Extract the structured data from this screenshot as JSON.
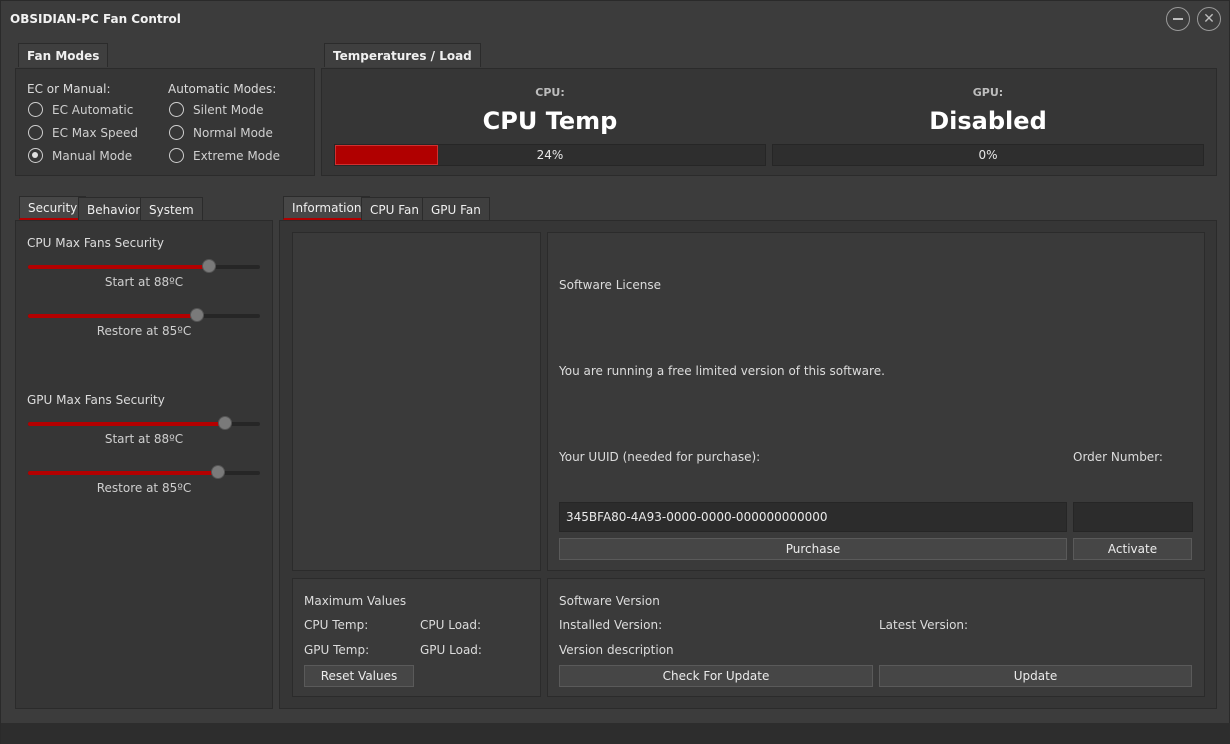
{
  "window": {
    "title": "OBSIDIAN-PC Fan Control"
  },
  "fan_modes": {
    "tab_label": "Fan Modes",
    "ec_manual_title": "EC or Manual:",
    "automatic_title": "Automatic Modes:",
    "ec_options": [
      {
        "label": "EC Automatic",
        "selected": false
      },
      {
        "label": "EC Max Speed",
        "selected": false
      },
      {
        "label": "Manual Mode",
        "selected": true
      }
    ],
    "auto_options": [
      {
        "label": "Silent Mode",
        "selected": false
      },
      {
        "label": "Normal Mode",
        "selected": false
      },
      {
        "label": "Extreme Mode",
        "selected": false
      }
    ]
  },
  "temps": {
    "tab_label": "Temperatures / Load",
    "cpu": {
      "heading": "CPU:",
      "value": "CPU Temp",
      "load_text": "24%",
      "load": 0.24
    },
    "gpu": {
      "heading": "GPU:",
      "value": "Disabled",
      "load_text": "0%",
      "load": 0
    }
  },
  "left_tabs": [
    "Security",
    "Behavior",
    "System"
  ],
  "security": {
    "cpu_title": "CPU Max Fans Security",
    "cpu_start_label": "Start at 88ºC",
    "cpu_start_level": 0.78,
    "cpu_restore_label": "Restore at 85ºC",
    "cpu_restore_level": 0.73,
    "gpu_title": "GPU Max Fans Security",
    "gpu_start_label": "Start at 88ºC",
    "gpu_start_level": 0.85,
    "gpu_restore_label": "Restore at 85ºC",
    "gpu_restore_level": 0.82
  },
  "right_tabs": [
    "Information",
    "CPU Fan",
    "GPU Fan"
  ],
  "license": {
    "title": "Software License",
    "message": "You are running a free limited version of this software.",
    "uuid_label": "Your UUID (needed for purchase):",
    "order_label": "Order Number:",
    "uuid_value": "345BFA80-4A93-0000-0000-000000000000",
    "order_value": "",
    "purchase_label": "Purchase",
    "activate_label": "Activate"
  },
  "max_values": {
    "title": "Maximum Values",
    "cpu_temp": "CPU Temp:",
    "cpu_load": "CPU Load:",
    "gpu_temp": "GPU Temp:",
    "gpu_load": "GPU Load:",
    "reset_label": "Reset Values"
  },
  "version": {
    "title": "Software Version",
    "installed": "Installed Version:",
    "latest": "Latest Version:",
    "description": "Version description",
    "check_label": "Check For Update",
    "update_label": "Update"
  },
  "colors": {
    "accent": "#b00000",
    "background": "#3c3c3c"
  }
}
